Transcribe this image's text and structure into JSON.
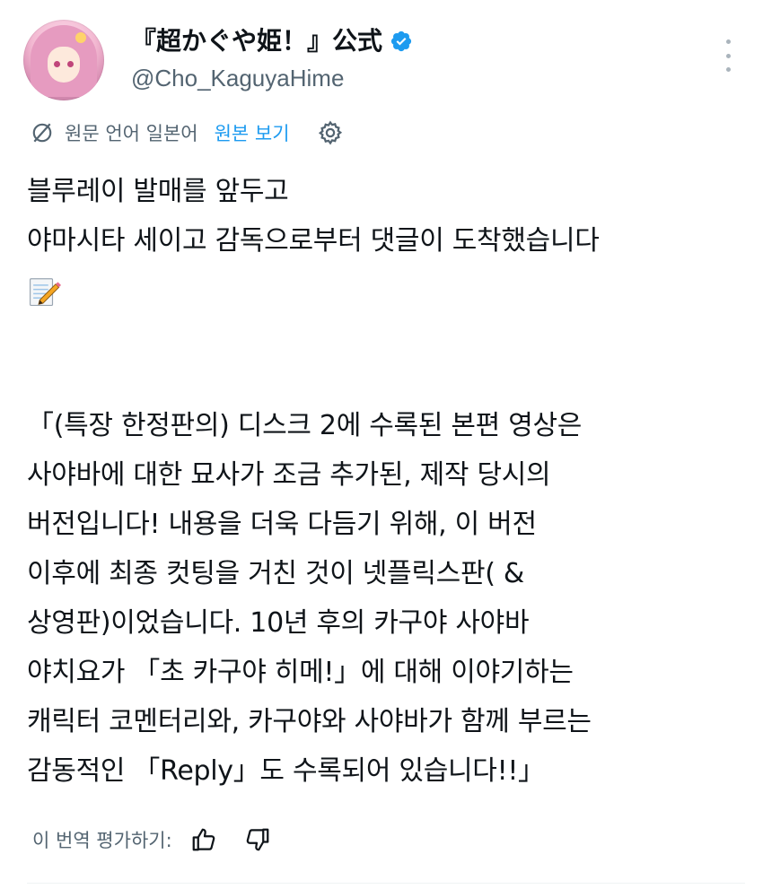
{
  "account": {
    "display_name": "『超かぐや姫！』公式",
    "handle": "@Cho_KaguyaHime"
  },
  "translation": {
    "source_label": "원문 언어 일본어",
    "show_original": "원본 보기"
  },
  "tweet": {
    "lines": [
      "블루레이 발매를 앞두고",
      "야마시타 세이고 감독으로부터 댓글이 도착했습니다",
      "「(특장 한정판의) 디스크 2에 수록된 본편 영상은",
      "사야바에 대한 묘사가 조금 추가된, 제작 당시의",
      "버전입니다! 내용을 더욱 다듬기 위해, 이 버전",
      "이후에 최종 컷팅을 거친 것이 넷플릭스판( &",
      "상영판)이었습니다. 10년 후의 카구야 사야바",
      "야치요가 「초 카구야 히메!」에 대해 이야기하는",
      "캐릭터 코멘터리와, 카구야와 사야바가 함께 부르는",
      "감동적인 「Reply」도 수록되어 있습니다!!」"
    ]
  },
  "rating": {
    "label": "이 번역 평가하기:"
  },
  "colors": {
    "accent": "#1d9bf0",
    "secondary_text": "#536471",
    "primary_text": "#0f1419"
  }
}
